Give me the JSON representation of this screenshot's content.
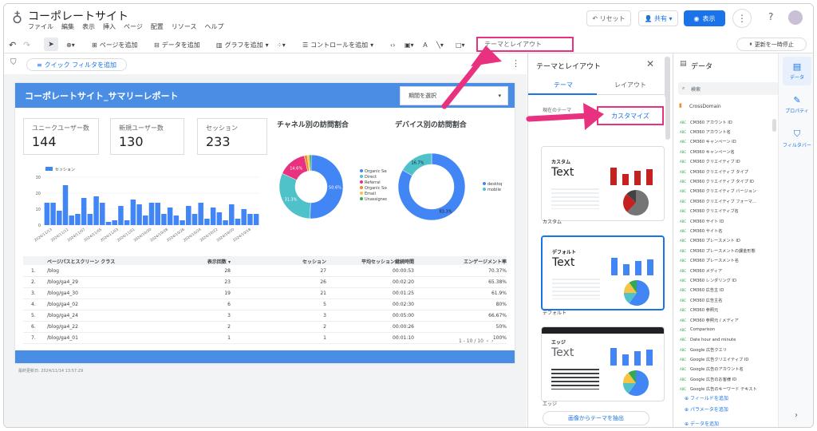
{
  "app": {
    "title": "コーポレートサイト",
    "menu": [
      "ファイル",
      "編集",
      "表示",
      "挿入",
      "ページ",
      "配置",
      "リソース",
      "ヘルプ"
    ],
    "reset_label": "リセット",
    "share_label": "共有",
    "view_label": "表示"
  },
  "toolbar": {
    "add_page": "ページを追加",
    "add_data": "データを追加",
    "add_chart": "グラフを追加",
    "add_control": "コントロールを追加",
    "theme_layout": "テーマとレイアウト",
    "pause_update": "更新を一時停止"
  },
  "filter": {
    "quick_filter": "クイック フィルタを追加"
  },
  "report": {
    "title": "コーポレートサイト_サマリーレポート",
    "date_selector": "期間を選択",
    "kpis": [
      {
        "label": "ユニークユーザー数",
        "value": "144"
      },
      {
        "label": "新規ユーザー数",
        "value": "130"
      },
      {
        "label": "セッション",
        "value": "233"
      }
    ],
    "channel_title": "チャネル別の訪問割合",
    "device_title": "デバイス別の訪問割合",
    "last_updated": "最終更新日: 2024/11/14 13:57:29",
    "pager": "1 - 10 / 10"
  },
  "chart_data": [
    {
      "type": "bar",
      "legend": [
        "セッション"
      ],
      "ylim": [
        0,
        30
      ],
      "yticks": [
        0,
        10,
        20,
        30
      ],
      "xticks": [
        "2024/11/13",
        "2024/11/11",
        "2024/11/07",
        "2024/11/05",
        "2024/11/03",
        "2024/11/01",
        "2024/10/30",
        "2024/10/28",
        "2024/10/26",
        "2024/10/24",
        "2024/10/22",
        "2024/10/20",
        "2024/10/18"
      ],
      "series": [
        {
          "name": "セッション",
          "values": [
            14,
            14,
            9,
            25,
            6,
            7,
            17,
            7,
            18,
            14,
            2,
            3,
            12,
            3,
            16,
            13,
            6,
            14,
            14,
            7,
            11,
            6,
            3,
            12,
            7,
            14,
            4,
            11,
            8,
            3,
            13,
            4,
            10,
            7,
            7
          ]
        }
      ]
    },
    {
      "type": "pie",
      "title": "チャネル別の訪問割合",
      "labels": [
        "Organic Search",
        "Direct",
        "Referral",
        "Organic Social",
        "Email",
        "Unassigned"
      ],
      "values": [
        50.6,
        31.3,
        14.6,
        1.5,
        1.0,
        1.0
      ],
      "data_labels": [
        "50.6%",
        "31.3%",
        "14.6%"
      ],
      "colors": [
        "#4285f4",
        "#4ec1c9",
        "#e8317f",
        "#f28b22",
        "#f6c344",
        "#34a853"
      ]
    },
    {
      "type": "pie",
      "title": "デバイス別の訪問割合",
      "labels": [
        "desktop",
        "mobile"
      ],
      "values": [
        83.3,
        16.7
      ],
      "data_labels": [
        "83.3%",
        "16.7%"
      ],
      "colors": [
        "#4285f4",
        "#4ec1c9"
      ]
    },
    {
      "type": "table",
      "columns": [
        "",
        "ページパスとスクリーン クラス",
        "表示回数 ▾",
        "セッション",
        "平均セッション継続時間",
        "エンゲージメント率"
      ],
      "rows": [
        [
          "1.",
          "/blog",
          "28",
          "27",
          "00:00:53",
          "70.37%"
        ],
        [
          "2.",
          "/blog/ga4_29",
          "23",
          "26",
          "00:02:20",
          "65.38%"
        ],
        [
          "3.",
          "/blog/ga4_30",
          "19",
          "21",
          "00:01:25",
          "61.9%"
        ],
        [
          "4.",
          "/blog/ga4_02",
          "6",
          "5",
          "00:02:30",
          "80%"
        ],
        [
          "5.",
          "/blog/ga4_24",
          "3",
          "3",
          "00:05:00",
          "66.67%"
        ],
        [
          "6.",
          "/blog/ga4_22",
          "2",
          "2",
          "00:00:26",
          "50%"
        ],
        [
          "7.",
          "/blog/ga4_01",
          "1",
          "1",
          "00:01:10",
          "100%"
        ]
      ]
    }
  ],
  "theme_panel": {
    "title": "テーマとレイアウト",
    "tabs": [
      "テーマ",
      "レイアウト"
    ],
    "current_label": "現在のテーマ",
    "current_value": "デフォルト",
    "customize": "カスタマイズ",
    "cards": [
      {
        "name": "カスタム",
        "text": "Text",
        "label": "カスタム"
      },
      {
        "name": "デフォルト",
        "text": "Text",
        "label": "デフォルト"
      },
      {
        "name": "エッジ",
        "text": "Text",
        "label": "エッジ"
      }
    ],
    "extract": "画像からテーマを抽出"
  },
  "data_panel": {
    "title": "データ",
    "search_placeholder": "検索",
    "source": "CrossDomain",
    "fields": [
      "CM360 アカウント ID",
      "CM360 アカウント名",
      "CM360 キャンペーン ID",
      "CM360 キャンペーン名",
      "CM360 クリエイティブ ID",
      "CM360 クリエイティブ タイプ",
      "CM360 クリエイティブ タイプ ID",
      "CM360 クリエイティブ バージョン",
      "CM360 クリエイティブ フォーマ...",
      "CM360 クリエイティブ名",
      "CM360 サイト ID",
      "CM360 サイト名",
      "CM360 プレースメント ID",
      "CM360 プレースメントの課金形態",
      "CM360 プレースメント名",
      "CM360 メディア",
      "CM360 レンダリング ID",
      "CM360 広告主 ID",
      "CM360 広告主名",
      "CM360 参照元",
      "CM360 参照元 / メディア",
      "Comparison",
      "Date hour and minute",
      "Google 広告クエリ",
      "Google 広告クリエイティブ ID",
      "Google 広告のアカウント名",
      "Google 広告のお客様 ID",
      "Google 広告のキーワード テキスト"
    ],
    "add_field": "フィールドを追加",
    "add_param": "パラメータを追加",
    "add_data": "データを追加"
  },
  "side_tabs": [
    "データ",
    "プロパティ",
    "フィルタバー"
  ]
}
